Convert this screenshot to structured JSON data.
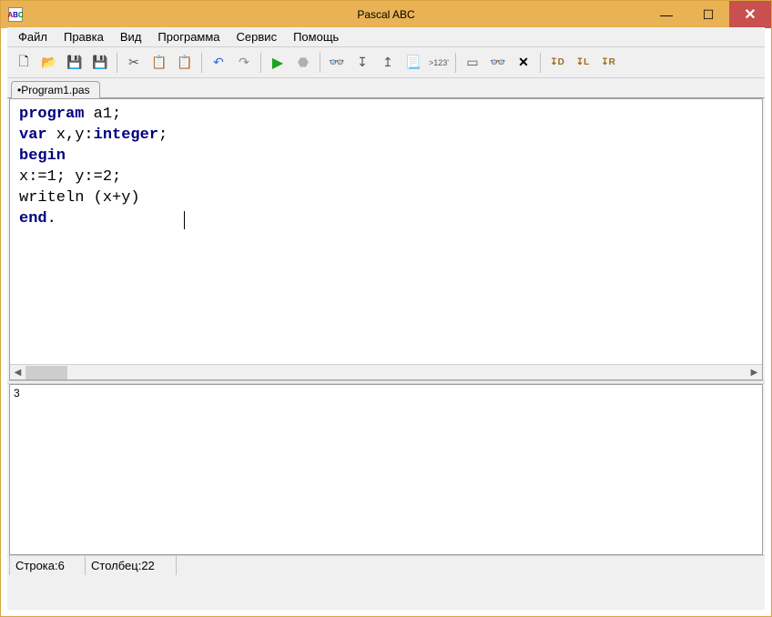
{
  "window": {
    "title": "Pascal ABC"
  },
  "menu": {
    "items": [
      "Файл",
      "Правка",
      "Вид",
      "Программа",
      "Сервис",
      "Помощь"
    ]
  },
  "toolbar_icons": {
    "new": "new-file-icon",
    "open": "open-file-icon",
    "save": "save-icon",
    "saveall": "save-all-icon",
    "cut": "cut-icon",
    "copy": "copy-icon",
    "paste": "paste-icon",
    "undo": "undo-icon",
    "redo": "redo-icon",
    "run": "run-icon",
    "stop": "stop-icon",
    "trace": "step-over-icon",
    "stepin": "step-into-icon",
    "stepout": "step-out-icon",
    "eval": "evaluate-icon",
    "var": "variable-watch-icon",
    "showout": "show-output-icon",
    "watchwin": "watch-window-icon",
    "clear": "clear-icon",
    "d": "debug-d-icon",
    "l": "debug-l-icon",
    "r": "debug-r-icon"
  },
  "tabs": {
    "active": "•Program1.pas"
  },
  "code": {
    "l1_kw": "program",
    "l1_rest": " a1;",
    "l2_kw": "var",
    "l2_mid": " x,y:",
    "l2_type": "integer",
    "l2_end": ";",
    "l3_kw": "begin",
    "l4": "x:=1; y:=2;",
    "l5": "writeln (x+y)",
    "l6_kw": "end",
    "l6_rest": "."
  },
  "output": {
    "text": "3"
  },
  "status": {
    "line_label": "Строка: ",
    "line_value": "6",
    "col_label": "Столбец: ",
    "col_value": "22"
  },
  "app_icon_text": {
    "a": "A",
    "b": "B",
    "c": "C"
  }
}
